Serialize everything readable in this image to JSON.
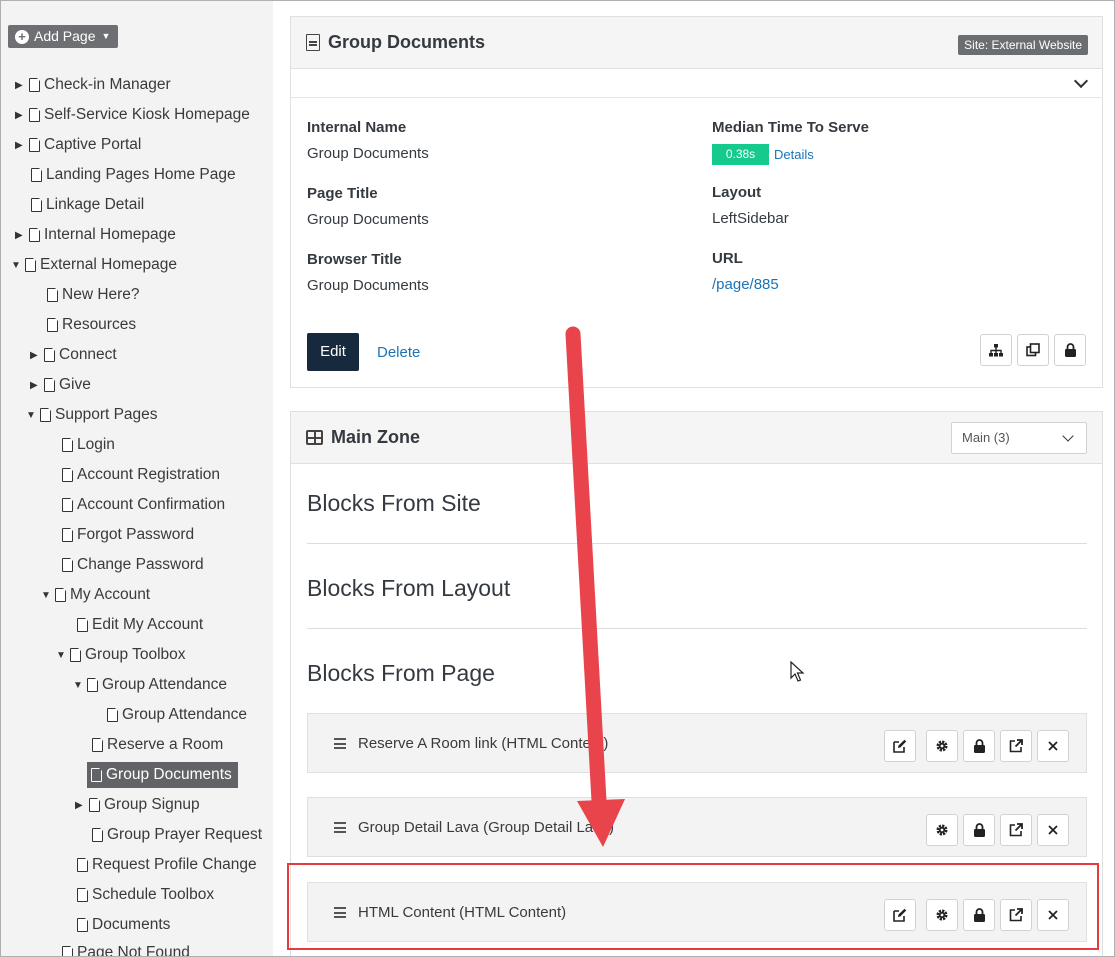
{
  "sidebar": {
    "add_page_label": "Add Page",
    "tree": [
      {
        "label": "Check-in Manager",
        "toggle": "▶"
      },
      {
        "label": "Self-Service Kiosk Homepage",
        "toggle": "▶"
      },
      {
        "label": "Captive Portal",
        "toggle": "▶"
      },
      {
        "label": "Landing Pages Home Page",
        "toggle": ""
      },
      {
        "label": "Linkage Detail",
        "toggle": ""
      },
      {
        "label": "Internal Homepage",
        "toggle": "▶"
      },
      {
        "label": "External Homepage",
        "toggle": "▼"
      },
      {
        "label": "New Here?",
        "toggle": ""
      },
      {
        "label": "Resources",
        "toggle": ""
      },
      {
        "label": "Connect",
        "toggle": "▶"
      },
      {
        "label": "Give",
        "toggle": "▶"
      },
      {
        "label": "Support Pages",
        "toggle": "▼"
      },
      {
        "label": "Login",
        "toggle": ""
      },
      {
        "label": "Account Registration",
        "toggle": ""
      },
      {
        "label": "Account Confirmation",
        "toggle": ""
      },
      {
        "label": "Forgot Password",
        "toggle": ""
      },
      {
        "label": "Change Password",
        "toggle": ""
      },
      {
        "label": "My Account",
        "toggle": "▼"
      },
      {
        "label": "Edit My Account",
        "toggle": ""
      },
      {
        "label": "Group Toolbox",
        "toggle": "▼"
      },
      {
        "label": "Group Attendance",
        "toggle": "▼"
      },
      {
        "label": "Group Attendance",
        "toggle": ""
      },
      {
        "label": "Reserve a Room",
        "toggle": ""
      },
      {
        "label": "Group Documents",
        "toggle": ""
      },
      {
        "label": "Group Signup",
        "toggle": "▶"
      },
      {
        "label": "Group Prayer Request",
        "toggle": ""
      },
      {
        "label": "Request Profile Change",
        "toggle": ""
      },
      {
        "label": "Schedule Toolbox",
        "toggle": ""
      },
      {
        "label": "Documents",
        "toggle": ""
      },
      {
        "label": "Page Not Found",
        "toggle": ""
      }
    ]
  },
  "page_panel": {
    "title": "Group Documents",
    "site_badge": "Site: External Website",
    "internal_name_label": "Internal Name",
    "internal_name": "Group Documents",
    "page_title_label": "Page Title",
    "page_title": "Group Documents",
    "browser_title_label": "Browser Title",
    "browser_title": "Group Documents",
    "median_label": "Median Time To Serve",
    "median_value": "0.38s",
    "details_link": "Details",
    "layout_label": "Layout",
    "layout_value": "LeftSidebar",
    "url_label": "URL",
    "url_value": "/page/885",
    "edit_label": "Edit",
    "delete_label": "Delete"
  },
  "zone_panel": {
    "title": "Main Zone",
    "select_value": "Main (3)",
    "blocks_from_site": "Blocks From Site",
    "blocks_from_layout": "Blocks From Layout",
    "blocks_from_page": "Blocks From Page",
    "blocks": [
      {
        "name": "Reserve A Room link (HTML Content)"
      },
      {
        "name": "Group Detail Lava (Group Detail Lava)"
      },
      {
        "name": "HTML Content (HTML Content)"
      }
    ]
  },
  "colors": {
    "accent_green": "#16c98d",
    "edit_button": "#16293d",
    "link_blue": "#1a73b8",
    "annotation_red": "#e53a3e"
  }
}
